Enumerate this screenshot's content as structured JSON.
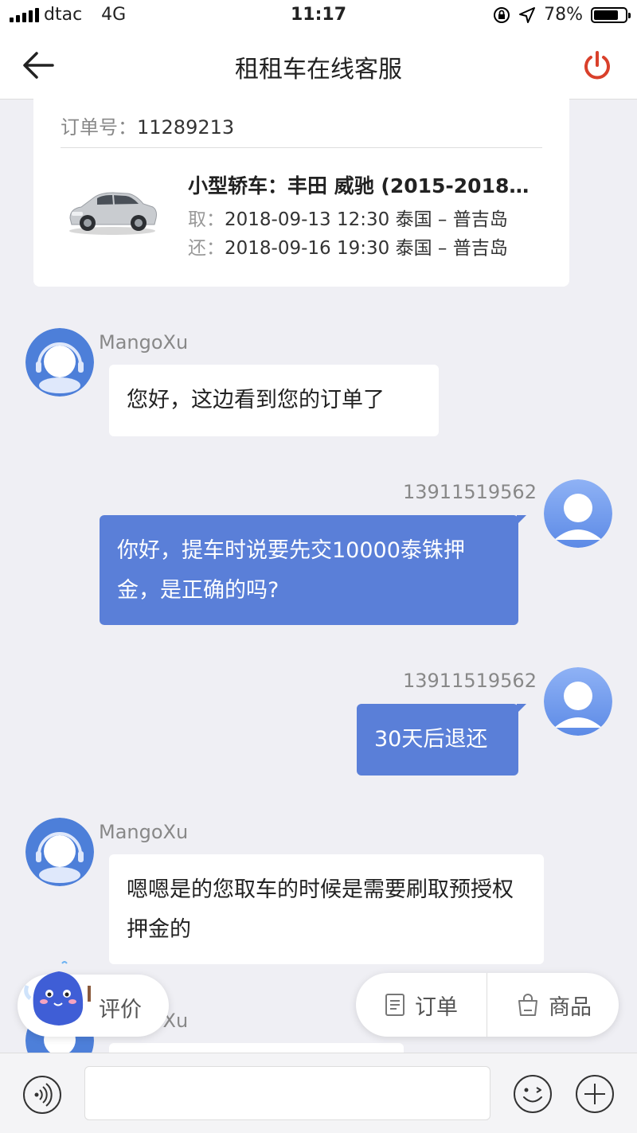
{
  "status_bar": {
    "carrier": "dtac",
    "network": "4G",
    "time": "11:17",
    "battery": "78%",
    "battery_level": 0.78
  },
  "nav": {
    "title": "租租车在线客服",
    "back_icon": "arrow-left-icon",
    "power_icon": "power-icon",
    "power_color": "#d9402b"
  },
  "order": {
    "number_label": "订单号：",
    "number": "11289213",
    "car_name": "小型轿车：丰田 威驰 (2015-2018…",
    "pickup_label": "取：",
    "pickup": "2018-09-13 12:30 泰国 – 普吉岛",
    "return_label": "还：",
    "return": "2018-09-16 19:30 泰国 – 普吉岛"
  },
  "messages": [
    {
      "sender": "MangoXu",
      "direction": "in",
      "text": "您好，这边看到您的订单了"
    },
    {
      "sender": "13911519562",
      "direction": "out",
      "text": "你好，提车时说要先交10000泰铢押金，是正确的吗?"
    },
    {
      "sender": "13911519562",
      "direction": "out",
      "text": "30天后退还"
    },
    {
      "sender": "MangoXu",
      "direction": "in",
      "text": "嗯嗯是的您取车的时候是需要刷取预授权押金的"
    },
    {
      "sender": "MangoXu",
      "direction": "in",
      "text": ""
    }
  ],
  "floating": {
    "rate_label": "评价",
    "order_label": "订单",
    "goods_label": "商品"
  },
  "input_bar": {
    "voice_icon": "voice-icon",
    "emoji_icon": "emoji-icon",
    "plus_icon": "plus-icon",
    "placeholder": ""
  },
  "colors": {
    "accent": "#5a7fd8",
    "background": "#efeff4"
  }
}
